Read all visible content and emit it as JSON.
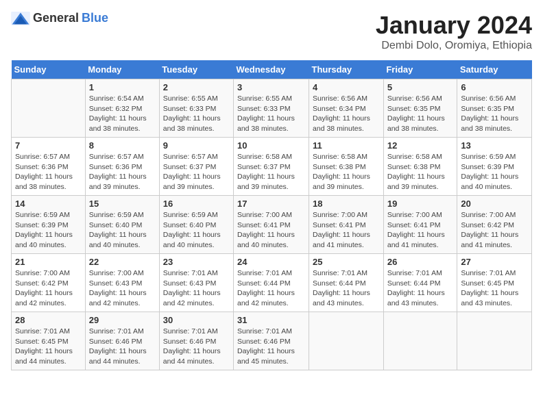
{
  "header": {
    "logo_general": "General",
    "logo_blue": "Blue",
    "title": "January 2024",
    "subtitle": "Dembi Dolo, Oromiya, Ethiopia"
  },
  "days_of_week": [
    "Sunday",
    "Monday",
    "Tuesday",
    "Wednesday",
    "Thursday",
    "Friday",
    "Saturday"
  ],
  "weeks": [
    [
      {
        "day": "",
        "info": ""
      },
      {
        "day": "1",
        "info": "Sunrise: 6:54 AM\nSunset: 6:32 PM\nDaylight: 11 hours\nand 38 minutes."
      },
      {
        "day": "2",
        "info": "Sunrise: 6:55 AM\nSunset: 6:33 PM\nDaylight: 11 hours\nand 38 minutes."
      },
      {
        "day": "3",
        "info": "Sunrise: 6:55 AM\nSunset: 6:33 PM\nDaylight: 11 hours\nand 38 minutes."
      },
      {
        "day": "4",
        "info": "Sunrise: 6:56 AM\nSunset: 6:34 PM\nDaylight: 11 hours\nand 38 minutes."
      },
      {
        "day": "5",
        "info": "Sunrise: 6:56 AM\nSunset: 6:35 PM\nDaylight: 11 hours\nand 38 minutes."
      },
      {
        "day": "6",
        "info": "Sunrise: 6:56 AM\nSunset: 6:35 PM\nDaylight: 11 hours\nand 38 minutes."
      }
    ],
    [
      {
        "day": "7",
        "info": "Sunrise: 6:57 AM\nSunset: 6:36 PM\nDaylight: 11 hours\nand 38 minutes."
      },
      {
        "day": "8",
        "info": "Sunrise: 6:57 AM\nSunset: 6:36 PM\nDaylight: 11 hours\nand 39 minutes."
      },
      {
        "day": "9",
        "info": "Sunrise: 6:57 AM\nSunset: 6:37 PM\nDaylight: 11 hours\nand 39 minutes."
      },
      {
        "day": "10",
        "info": "Sunrise: 6:58 AM\nSunset: 6:37 PM\nDaylight: 11 hours\nand 39 minutes."
      },
      {
        "day": "11",
        "info": "Sunrise: 6:58 AM\nSunset: 6:38 PM\nDaylight: 11 hours\nand 39 minutes."
      },
      {
        "day": "12",
        "info": "Sunrise: 6:58 AM\nSunset: 6:38 PM\nDaylight: 11 hours\nand 39 minutes."
      },
      {
        "day": "13",
        "info": "Sunrise: 6:59 AM\nSunset: 6:39 PM\nDaylight: 11 hours\nand 40 minutes."
      }
    ],
    [
      {
        "day": "14",
        "info": "Sunrise: 6:59 AM\nSunset: 6:39 PM\nDaylight: 11 hours\nand 40 minutes."
      },
      {
        "day": "15",
        "info": "Sunrise: 6:59 AM\nSunset: 6:40 PM\nDaylight: 11 hours\nand 40 minutes."
      },
      {
        "day": "16",
        "info": "Sunrise: 6:59 AM\nSunset: 6:40 PM\nDaylight: 11 hours\nand 40 minutes."
      },
      {
        "day": "17",
        "info": "Sunrise: 7:00 AM\nSunset: 6:41 PM\nDaylight: 11 hours\nand 40 minutes."
      },
      {
        "day": "18",
        "info": "Sunrise: 7:00 AM\nSunset: 6:41 PM\nDaylight: 11 hours\nand 41 minutes."
      },
      {
        "day": "19",
        "info": "Sunrise: 7:00 AM\nSunset: 6:41 PM\nDaylight: 11 hours\nand 41 minutes."
      },
      {
        "day": "20",
        "info": "Sunrise: 7:00 AM\nSunset: 6:42 PM\nDaylight: 11 hours\nand 41 minutes."
      }
    ],
    [
      {
        "day": "21",
        "info": "Sunrise: 7:00 AM\nSunset: 6:42 PM\nDaylight: 11 hours\nand 42 minutes."
      },
      {
        "day": "22",
        "info": "Sunrise: 7:00 AM\nSunset: 6:43 PM\nDaylight: 11 hours\nand 42 minutes."
      },
      {
        "day": "23",
        "info": "Sunrise: 7:01 AM\nSunset: 6:43 PM\nDaylight: 11 hours\nand 42 minutes."
      },
      {
        "day": "24",
        "info": "Sunrise: 7:01 AM\nSunset: 6:44 PM\nDaylight: 11 hours\nand 42 minutes."
      },
      {
        "day": "25",
        "info": "Sunrise: 7:01 AM\nSunset: 6:44 PM\nDaylight: 11 hours\nand 43 minutes."
      },
      {
        "day": "26",
        "info": "Sunrise: 7:01 AM\nSunset: 6:44 PM\nDaylight: 11 hours\nand 43 minutes."
      },
      {
        "day": "27",
        "info": "Sunrise: 7:01 AM\nSunset: 6:45 PM\nDaylight: 11 hours\nand 43 minutes."
      }
    ],
    [
      {
        "day": "28",
        "info": "Sunrise: 7:01 AM\nSunset: 6:45 PM\nDaylight: 11 hours\nand 44 minutes."
      },
      {
        "day": "29",
        "info": "Sunrise: 7:01 AM\nSunset: 6:46 PM\nDaylight: 11 hours\nand 44 minutes."
      },
      {
        "day": "30",
        "info": "Sunrise: 7:01 AM\nSunset: 6:46 PM\nDaylight: 11 hours\nand 44 minutes."
      },
      {
        "day": "31",
        "info": "Sunrise: 7:01 AM\nSunset: 6:46 PM\nDaylight: 11 hours\nand 45 minutes."
      },
      {
        "day": "",
        "info": ""
      },
      {
        "day": "",
        "info": ""
      },
      {
        "day": "",
        "info": ""
      }
    ]
  ]
}
